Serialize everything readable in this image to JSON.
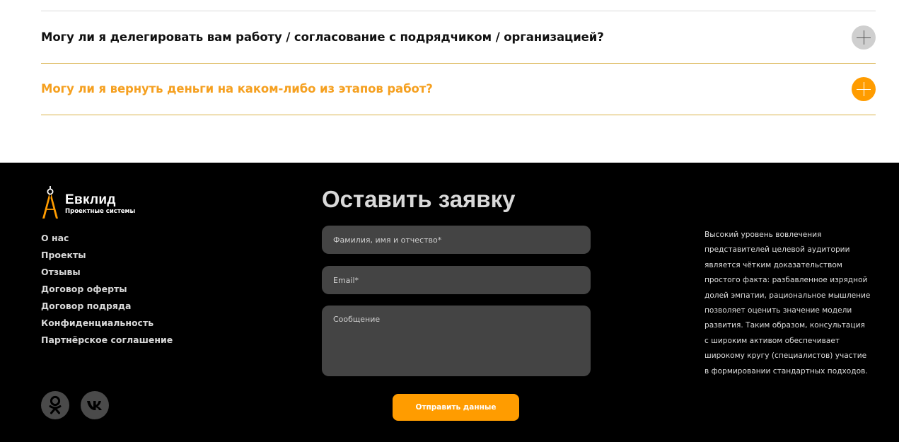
{
  "faq": {
    "items": [
      {
        "question": "Могу ли я делегировать вам работу / согласование с подрядчиком / организацией?",
        "active": false
      },
      {
        "question": "Могу ли я вернуть деньги на каком-либо из этапов работ?",
        "active": true
      }
    ]
  },
  "colors": {
    "accent": "#ff9c00",
    "active_question": "#f5a020",
    "footer_bg": "#000000",
    "field_bg": "#444444",
    "divider": "#d9b24a"
  },
  "footer": {
    "logo": {
      "title": "Евклид",
      "subtitle": "Проектные системы",
      "icon": "compass-icon"
    },
    "nav": [
      "О нас",
      "Проекты",
      "Отзывы",
      "Договор оферты",
      "Договор подряда",
      "Конфиденциальность",
      "Партнёрское соглашение"
    ],
    "social": [
      {
        "name": "odnoklassniki",
        "icon": "odnoklassniki-icon"
      },
      {
        "name": "vk",
        "icon": "vk-icon"
      }
    ]
  },
  "form": {
    "title": "Оставить заявку",
    "name_placeholder": "Фамилия, имя и отчество*",
    "email_placeholder": "Email*",
    "message_placeholder": "Сообщение",
    "submit_label": "Отправить данные"
  },
  "about": {
    "lines": [
      "Высокий уровень вовлечения",
      "представителей целевой аудитории",
      "является чётким доказательством",
      "простого факта: разбавленное изрядной",
      "долей эмпатии, рациональное мышление",
      "позволяет оценить значение модели",
      "развития. Таким образом, консультация",
      "с широким активом обеспечивает",
      "широкому кругу (специалистов) участие",
      "в формировании стандартных подходов."
    ]
  }
}
